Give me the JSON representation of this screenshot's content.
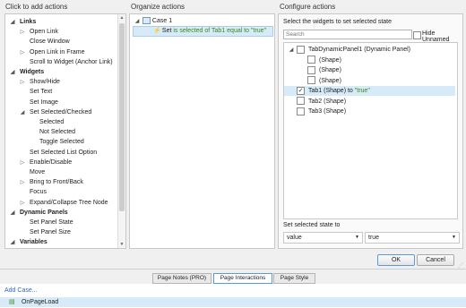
{
  "actions_panel": {
    "title": "Click to add actions",
    "items": [
      {
        "label": "Links",
        "tri": "◢",
        "bold": true,
        "indent": 0
      },
      {
        "label": "Open Link",
        "tri": "▷",
        "bold": false,
        "indent": 1
      },
      {
        "label": "Close Window",
        "tri": "",
        "bold": false,
        "indent": 1
      },
      {
        "label": "Open Link in Frame",
        "tri": "▷",
        "bold": false,
        "indent": 1
      },
      {
        "label": "Scroll to Widget (Anchor Link)",
        "tri": "",
        "bold": false,
        "indent": 1
      },
      {
        "label": "Widgets",
        "tri": "◢",
        "bold": true,
        "indent": 0
      },
      {
        "label": "Show/Hide",
        "tri": "▷",
        "bold": false,
        "indent": 1
      },
      {
        "label": "Set Text",
        "tri": "",
        "bold": false,
        "indent": 1
      },
      {
        "label": "Set Image",
        "tri": "",
        "bold": false,
        "indent": 1
      },
      {
        "label": "Set Selected/Checked",
        "tri": "◢",
        "bold": false,
        "indent": 1
      },
      {
        "label": "Selected",
        "tri": "",
        "bold": false,
        "indent": 2
      },
      {
        "label": "Not Selected",
        "tri": "",
        "bold": false,
        "indent": 2
      },
      {
        "label": "Toggle Selected",
        "tri": "",
        "bold": false,
        "indent": 2
      },
      {
        "label": "Set Selected List Option",
        "tri": "",
        "bold": false,
        "indent": 1
      },
      {
        "label": "Enable/Disable",
        "tri": "▷",
        "bold": false,
        "indent": 1
      },
      {
        "label": "Move",
        "tri": "",
        "bold": false,
        "indent": 1
      },
      {
        "label": "Bring to Front/Back",
        "tri": "▷",
        "bold": false,
        "indent": 1
      },
      {
        "label": "Focus",
        "tri": "",
        "bold": false,
        "indent": 1
      },
      {
        "label": "Expand/Collapse Tree Node",
        "tri": "▷",
        "bold": false,
        "indent": 1
      },
      {
        "label": "Dynamic Panels",
        "tri": "◢",
        "bold": true,
        "indent": 0
      },
      {
        "label": "Set Panel State",
        "tri": "",
        "bold": false,
        "indent": 1
      },
      {
        "label": "Set Panel Size",
        "tri": "",
        "bold": false,
        "indent": 1
      },
      {
        "label": "Variables",
        "tri": "◢",
        "bold": true,
        "indent": 0
      }
    ]
  },
  "organize_panel": {
    "title": "Organize actions",
    "case_label": "Case 1",
    "action": {
      "prefix": "Set ",
      "widget": "is selected of Tab1 equal to ",
      "value": "\"true\""
    }
  },
  "configure_panel": {
    "title": "Configure actions",
    "subtitle": "Select the widgets to set selected state",
    "search_placeholder": "Search",
    "hide_unnamed_label": "Hide Unnamed",
    "hide_unnamed_checked": false,
    "widgets": [
      {
        "label": "TabDynamicPanel1 (Dynamic Panel)",
        "suffix": "",
        "checked": false,
        "indent": 0,
        "selected": false,
        "tri": "◢"
      },
      {
        "label": "(Shape)",
        "suffix": "",
        "checked": false,
        "indent": 1,
        "selected": false,
        "tri": ""
      },
      {
        "label": "(Shape)",
        "suffix": "",
        "checked": false,
        "indent": 1,
        "selected": false,
        "tri": ""
      },
      {
        "label": "(Shape)",
        "suffix": "",
        "checked": false,
        "indent": 1,
        "selected": false,
        "tri": ""
      },
      {
        "label": "Tab1 (Shape) to ",
        "suffix": "\"true\"",
        "checked": true,
        "indent": 0,
        "selected": true,
        "tri": ""
      },
      {
        "label": "Tab2 (Shape)",
        "suffix": "",
        "checked": false,
        "indent": 0,
        "selected": false,
        "tri": ""
      },
      {
        "label": "Tab3 (Shape)",
        "suffix": "",
        "checked": false,
        "indent": 0,
        "selected": false,
        "tri": ""
      }
    ],
    "state_label": "Set selected state to",
    "state_type": "value",
    "state_value": "true"
  },
  "buttons": {
    "ok": "OK",
    "cancel": "Cancel"
  },
  "tabs": [
    {
      "label": "Page Notes (PRO)",
      "active": false
    },
    {
      "label": "Page Interactions",
      "active": true
    },
    {
      "label": "Page Style",
      "active": false
    }
  ],
  "bottom": {
    "add_case": "Add Case...",
    "event": "OnPageLoad"
  },
  "colors": {
    "selection": "#d6eaf8",
    "accent": "#5b9bd5",
    "green": "#3a8a1c"
  }
}
